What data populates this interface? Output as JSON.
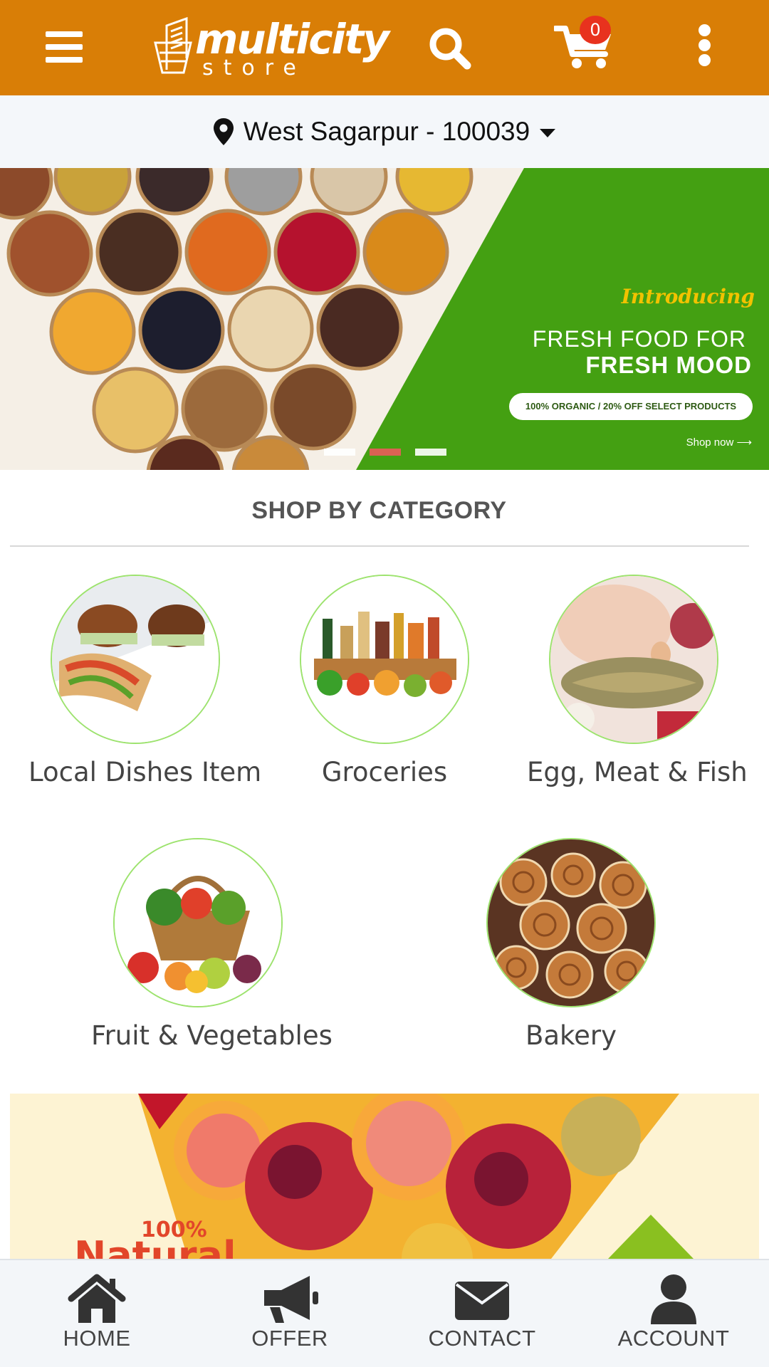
{
  "header": {
    "brand_main": "multicity",
    "brand_sub": "store",
    "cart_count": "0",
    "colors": {
      "bar": "#d97e06",
      "badge": "#e8321e"
    },
    "icons": [
      "menu-icon",
      "search-icon",
      "cart-icon",
      "more-icon"
    ]
  },
  "location": {
    "text": "West Sagarpur - 100039",
    "icon": "map-pin-icon"
  },
  "hero": {
    "intro": "Introducing",
    "line1": "FRESH FOOD FOR",
    "line2": "FRESH MOOD",
    "pill": "100% ORGANIC / 20% OFF SELECT PRODUCTS",
    "shop": "Shop now",
    "slides": 3,
    "active_slide": 2,
    "colors": {
      "green": "#44a012",
      "active_dot": "#ec5b5b"
    }
  },
  "category": {
    "title": "SHOP BY CATEGORY",
    "items": [
      {
        "label": "Local Dishes Item"
      },
      {
        "label": "Groceries"
      },
      {
        "label": "Egg, Meat & Fish"
      },
      {
        "label": "Fruit & Vegetables"
      },
      {
        "label": "Bakery"
      }
    ],
    "ring_color": "#9de36e"
  },
  "promo": {
    "percent": "100%",
    "word": "Natural"
  },
  "bottom_nav": [
    {
      "label": "HOME",
      "icon": "home-icon"
    },
    {
      "label": "OFFER",
      "icon": "megaphone-icon"
    },
    {
      "label": "CONTACT",
      "icon": "envelope-icon"
    },
    {
      "label": "ACCOUNT",
      "icon": "user-icon"
    }
  ]
}
